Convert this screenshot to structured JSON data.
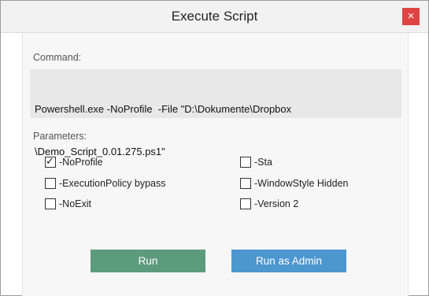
{
  "window": {
    "title": "Execute Script",
    "close_glyph": "×"
  },
  "command": {
    "label": "Command:",
    "line1": "Powershell.exe -NoProfile  -File \"D:\\Dokumente\\Dropbox",
    "line2": "\\Demo_Script_0.01.275.ps1\""
  },
  "parameters": {
    "label": "Parameters:",
    "left": [
      {
        "label": "-NoProfile",
        "checked": true
      },
      {
        "label": "-ExecutionPolicy bypass",
        "checked": false
      },
      {
        "label": "-NoExit",
        "checked": false
      }
    ],
    "right": [
      {
        "label": "-Sta",
        "checked": false
      },
      {
        "label": "-WindowStyle Hidden",
        "checked": false
      },
      {
        "label": "-Version 2",
        "checked": false
      }
    ]
  },
  "buttons": {
    "run": "Run",
    "run_as_admin": "Run as Admin"
  },
  "colors": {
    "close": "#e04343",
    "run": "#5c9b7c",
    "admin": "#4d97cf"
  }
}
